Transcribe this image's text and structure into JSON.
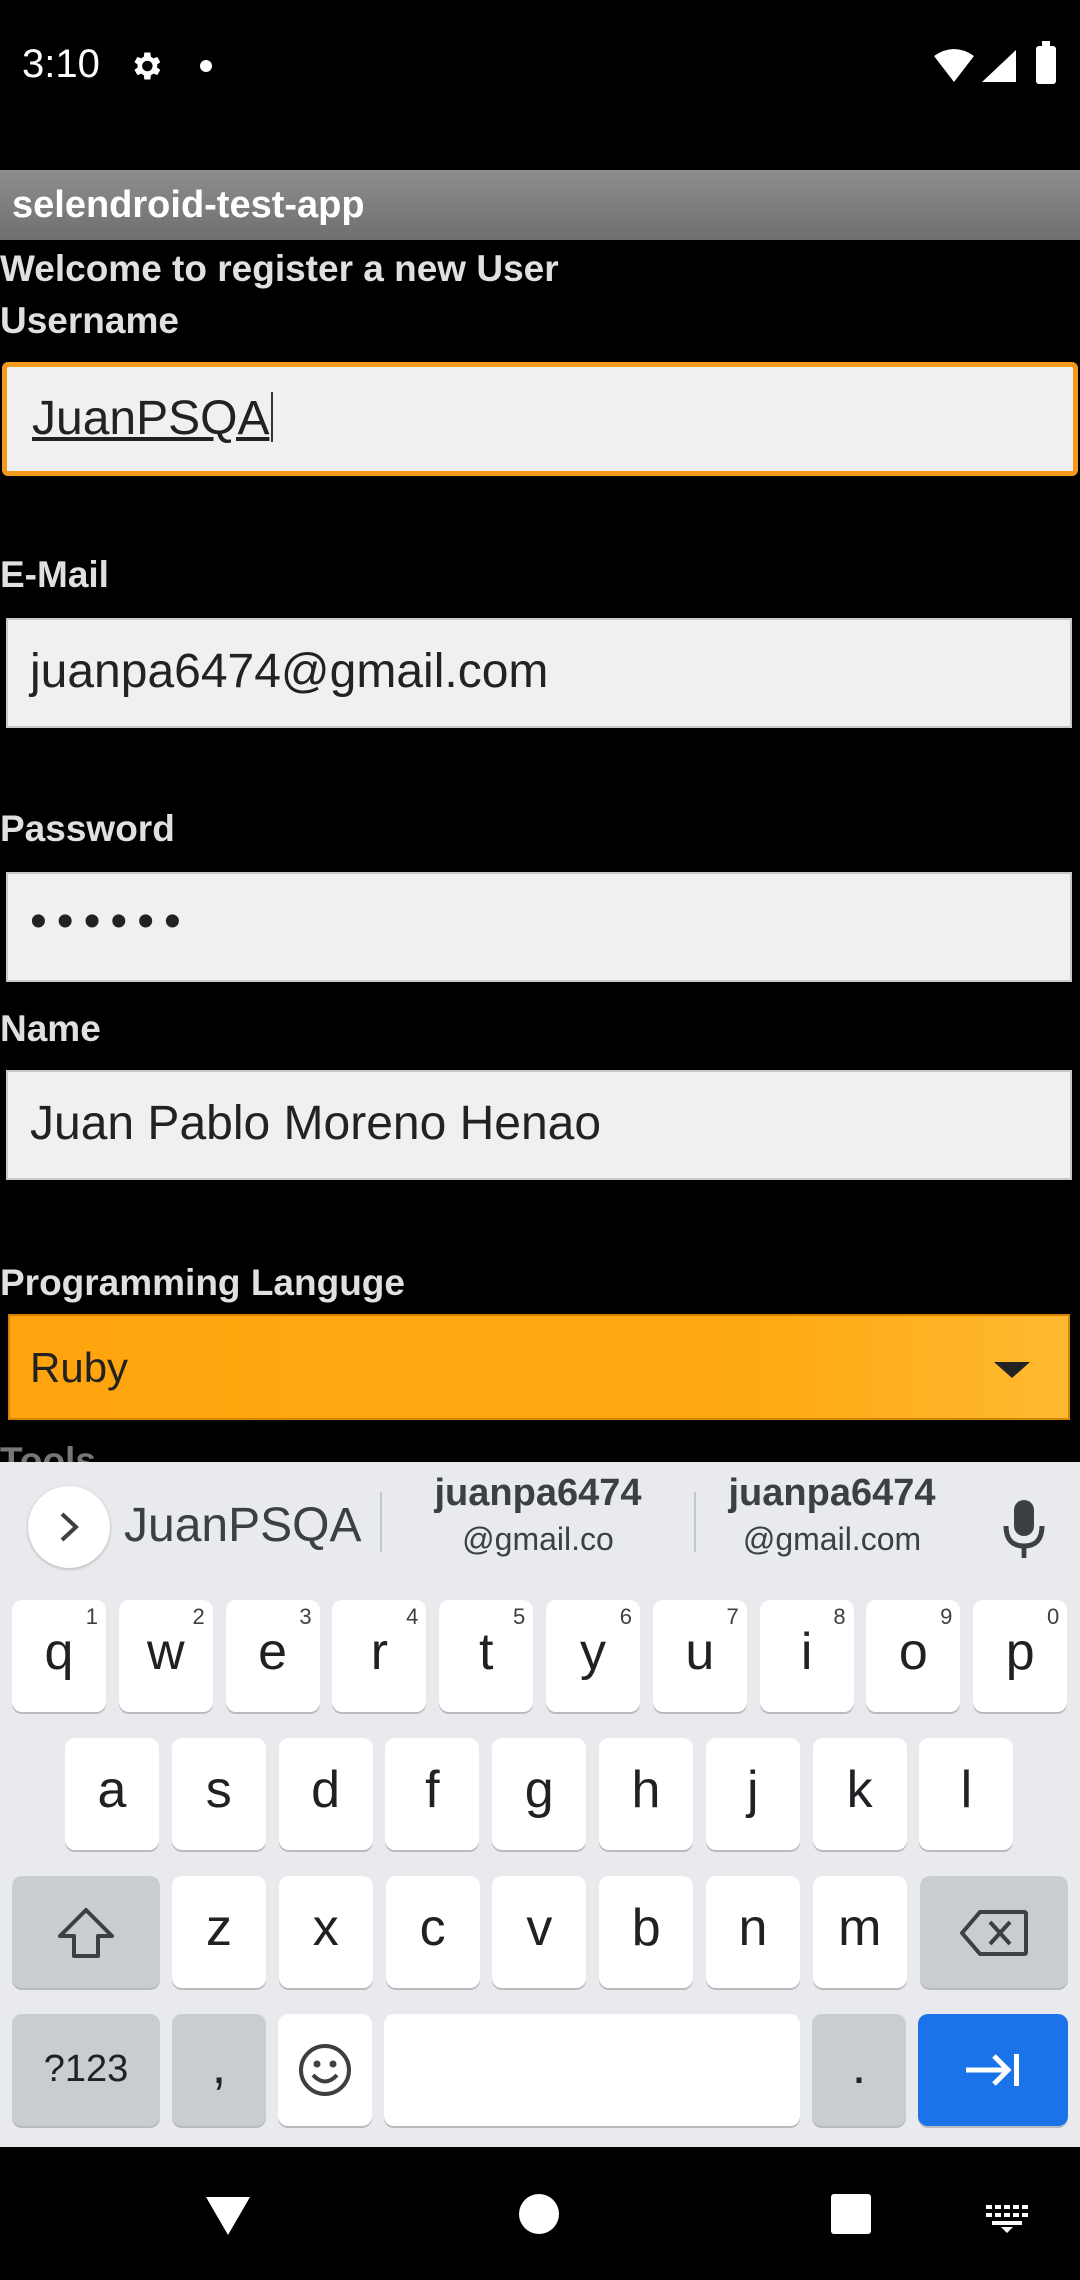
{
  "status_bar": {
    "time": "3:10",
    "icons": [
      "gear-icon",
      "notification-dot-icon",
      "wifi-icon",
      "signal-icon",
      "battery-icon"
    ]
  },
  "app": {
    "title": "selendroid-test-app"
  },
  "form": {
    "welcome": "Welcome to register a new User",
    "username_label": "Username",
    "username_value": "JuanPSQA",
    "email_label": "E-Mail",
    "email_value": "juanpa6474@gmail.com",
    "password_label": "Password",
    "password_value": "••••••",
    "name_label": "Name",
    "name_value": "Juan Pablo Moreno Henao",
    "language_label": "Programming Languge",
    "language_value": "Ruby",
    "next_label_partial": "Tools"
  },
  "keyboard": {
    "suggestions": {
      "first": "JuanPSQA",
      "second_line1": "juanpa6474",
      "second_line2": "@gmail.co",
      "third_line1": "juanpa6474",
      "third_line2": "@gmail.com"
    },
    "row1": [
      {
        "k": "q",
        "s": "1"
      },
      {
        "k": "w",
        "s": "2"
      },
      {
        "k": "e",
        "s": "3"
      },
      {
        "k": "r",
        "s": "4"
      },
      {
        "k": "t",
        "s": "5"
      },
      {
        "k": "y",
        "s": "6"
      },
      {
        "k": "u",
        "s": "7"
      },
      {
        "k": "i",
        "s": "8"
      },
      {
        "k": "o",
        "s": "9"
      },
      {
        "k": "p",
        "s": "0"
      }
    ],
    "row2": [
      "a",
      "s",
      "d",
      "f",
      "g",
      "h",
      "j",
      "k",
      "l"
    ],
    "row3": [
      "z",
      "x",
      "c",
      "v",
      "b",
      "n",
      "m"
    ],
    "symbols_label": "?123",
    "comma_label": ",",
    "period_label": ".",
    "accent_color": "#1a73e8"
  },
  "nav": {
    "icons": [
      "back-icon",
      "home-icon",
      "recents-icon",
      "keyboard-switch-icon"
    ]
  }
}
